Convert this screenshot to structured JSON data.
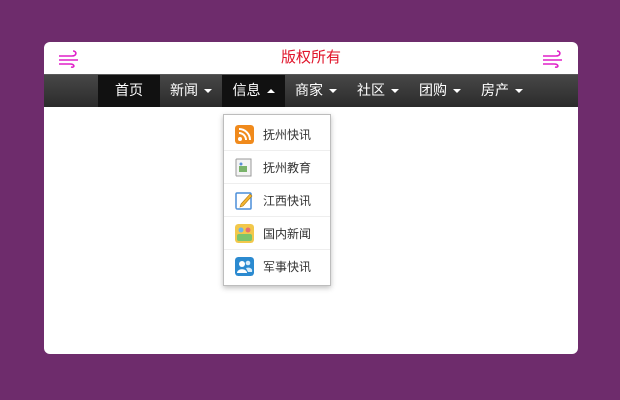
{
  "header": {
    "title": "版权所有"
  },
  "nav": {
    "items": [
      {
        "label": "首页"
      },
      {
        "label": "新闻"
      },
      {
        "label": "信息"
      },
      {
        "label": "商家"
      },
      {
        "label": "社区"
      },
      {
        "label": "团购"
      },
      {
        "label": "房产"
      }
    ]
  },
  "dropdown": {
    "items": [
      {
        "label": "抚州快讯",
        "icon": "rss-icon"
      },
      {
        "label": "抚州教育",
        "icon": "broken-image-icon"
      },
      {
        "label": "江西快讯",
        "icon": "edit-note-icon"
      },
      {
        "label": "国内新闻",
        "icon": "community-icon"
      },
      {
        "label": "军事快讯",
        "icon": "users-icon"
      }
    ]
  },
  "colors": {
    "background": "#6e2c6c",
    "title": "#e0142a",
    "nav_bg": "#333333",
    "nav_active": "#111111",
    "deco": "#e020c8"
  }
}
